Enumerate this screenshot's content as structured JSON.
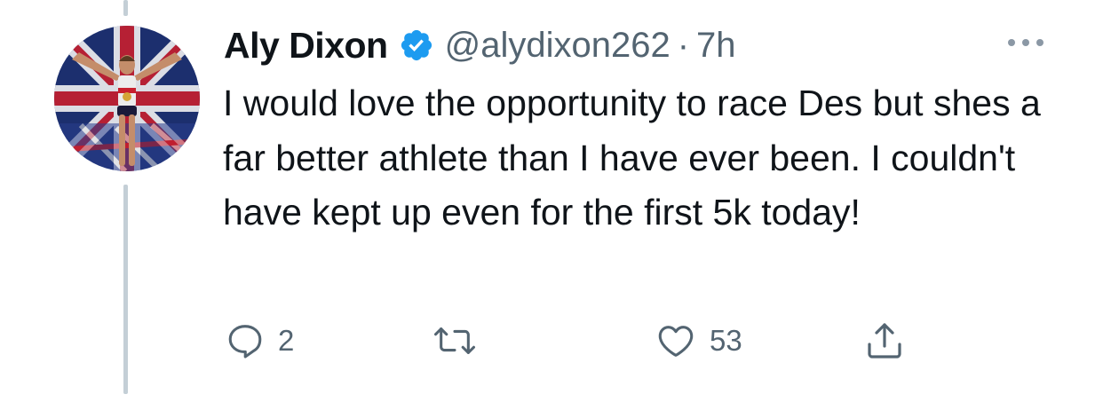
{
  "tweet": {
    "author_name": "Aly Dixon",
    "handle": "@alydixon262",
    "separator": "·",
    "time": "7h",
    "verified": true,
    "text": "I would love the opportunity to race Des but shes a far better athlete than I have ever been. I couldn't have kept up even for the first 5k today!",
    "avatar_icon": "profile-photo"
  },
  "actions": {
    "reply": {
      "icon": "reply-bubble-icon",
      "count": "2"
    },
    "retweet": {
      "icon": "retweet-icon",
      "count": ""
    },
    "like": {
      "icon": "heart-icon",
      "count": "53"
    },
    "share": {
      "icon": "share-icon"
    }
  },
  "colors": {
    "text_primary": "#0f1419",
    "text_secondary": "#536471",
    "verified_blue": "#1d9bf0",
    "thread_line": "#c4cfd6"
  }
}
